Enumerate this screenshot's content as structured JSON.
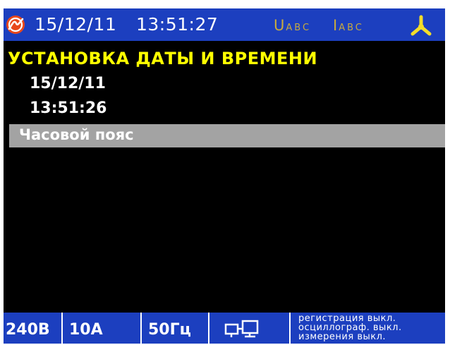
{
  "status_bar": {
    "date": "15/12/11",
    "time": "13:51:27",
    "voltage_indicator": {
      "main": "U",
      "sub": "ABC"
    },
    "current_indicator": {
      "main": "I",
      "sub": "ABC"
    },
    "logo_icon": "brand-logo-icon",
    "phase_icon": "three-phase-icon"
  },
  "menu": {
    "title": "УСТАНОВКА ДАТЫ И ВРЕМЕНИ",
    "date_value": "15/12/11",
    "time_value": "13:51:26",
    "timezone_label": "Часовой пояс"
  },
  "bottom_bar": {
    "voltage": "240В",
    "current": "10А",
    "frequency": "50Гц",
    "connection_icon": "pc-connection-icon",
    "status_lines": [
      "регистрация выкл.",
      "осциллограф. выкл.",
      "измерения выкл."
    ]
  },
  "colors": {
    "bar_blue": "#1c3fbf",
    "title_yellow": "#ffff00",
    "indicator_gold": "#c7aa3e",
    "selection_gray": "#a3a3a3",
    "logo_orange": "#e8481b",
    "phase_icon_yellow": "#f3dd2a"
  }
}
